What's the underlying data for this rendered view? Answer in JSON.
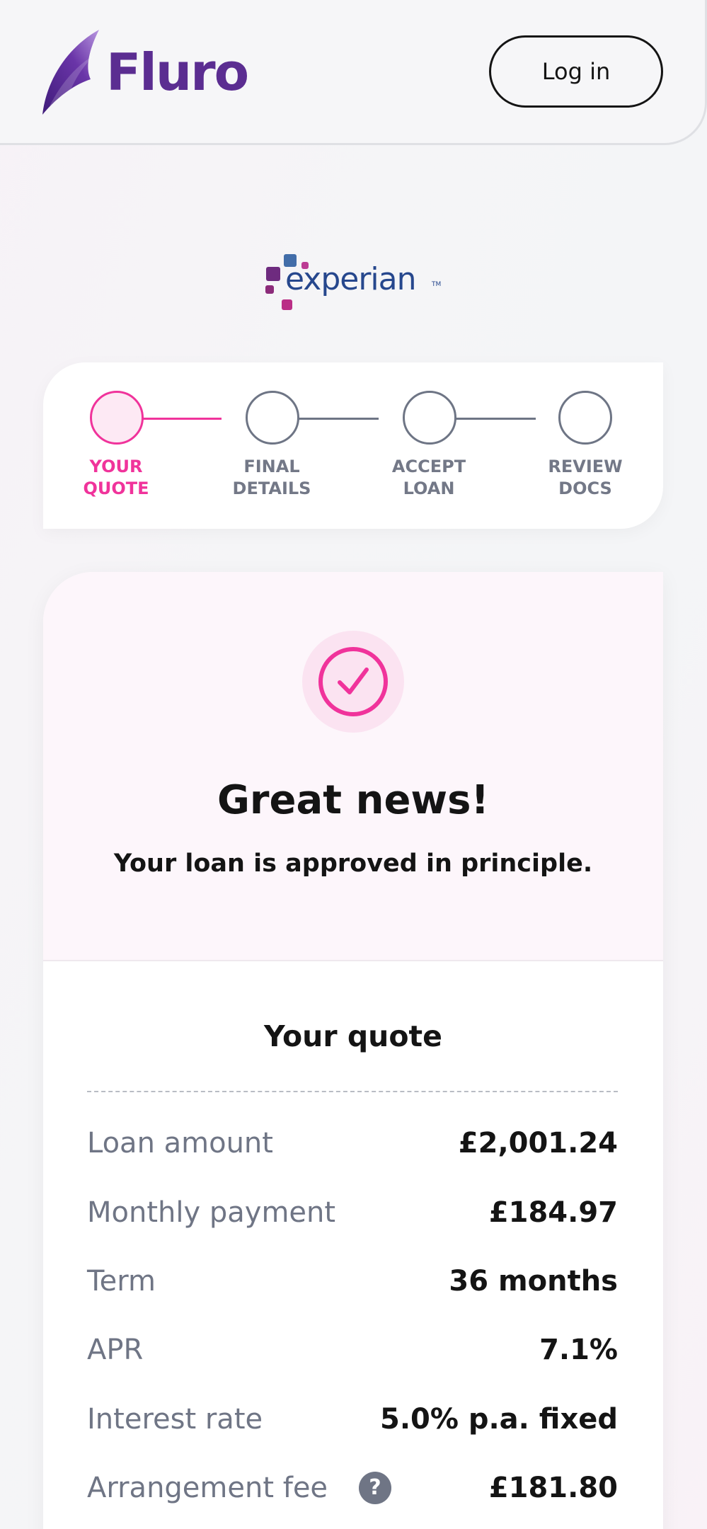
{
  "header": {
    "brand": "Fluro",
    "login_label": "Log in"
  },
  "partner": {
    "name": "experian",
    "tm": "TM"
  },
  "stepper": {
    "steps": [
      {
        "label": "YOUR\nQUOTE",
        "state": "active"
      },
      {
        "label": "FINAL\nDETAILS",
        "state": "pending"
      },
      {
        "label": "ACCEPT\nLOAN",
        "state": "pending"
      },
      {
        "label": "REVIEW\nDOCS",
        "state": "pending"
      }
    ]
  },
  "approval": {
    "icon": "check-circle-icon",
    "headline": "Great news!",
    "message": "Your loan is approved in principle."
  },
  "quote": {
    "title": "Your quote",
    "rows": [
      {
        "label": "Loan amount",
        "value": "£2,001.24"
      },
      {
        "label": "Monthly payment",
        "value": "£184.97"
      },
      {
        "label": "Term",
        "value": "36 months"
      },
      {
        "label": "APR",
        "value": "7.1%"
      },
      {
        "label": "Interest rate",
        "value": "5.0% p.a. fixed"
      },
      {
        "label": "Arrangement fee",
        "value": "£181.80",
        "help": "?"
      }
    ]
  },
  "colors": {
    "brand_purple": "#5b2d91",
    "accent_pink": "#f0339b",
    "text_dark": "#141414",
    "text_muted": "#6f7585"
  }
}
